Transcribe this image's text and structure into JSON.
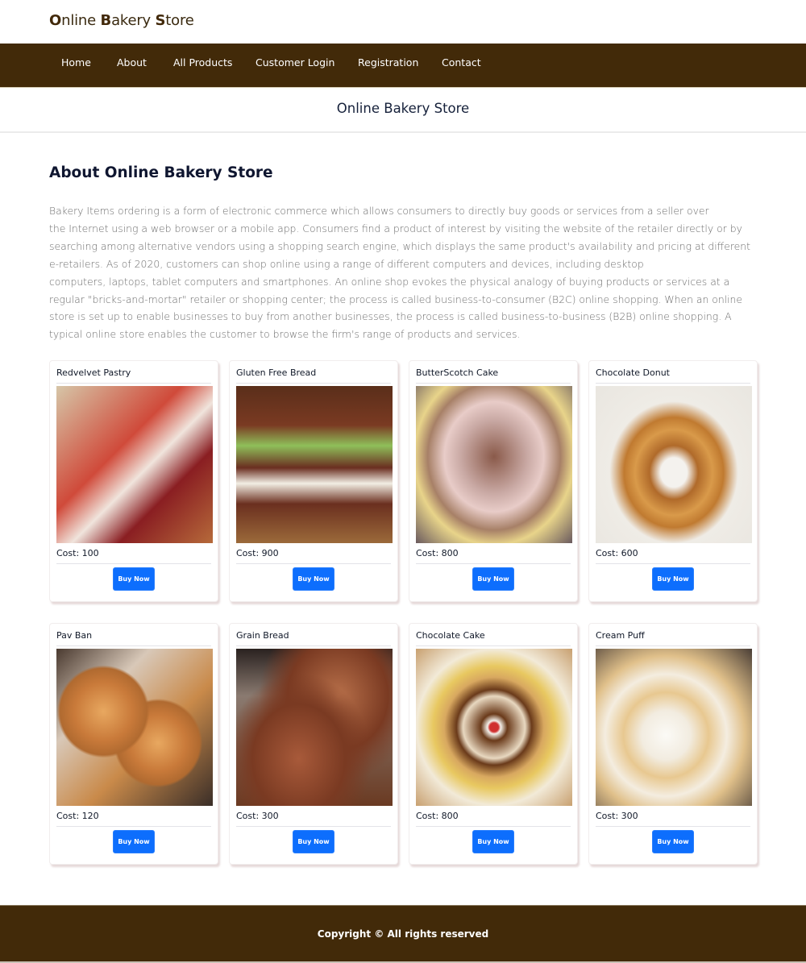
{
  "brand": {
    "first": "O",
    "rest1": "nline ",
    "second": "B",
    "rest2": "akery ",
    "third": "S",
    "rest3": "tore"
  },
  "nav": {
    "items": [
      {
        "label": "Home"
      },
      {
        "label": "About"
      },
      {
        "label": "All Products"
      },
      {
        "label": "Customer Login"
      },
      {
        "label": "Registration"
      },
      {
        "label": "Contact"
      }
    ]
  },
  "subheader": {
    "title": "Online Bakery Store"
  },
  "about": {
    "title": "About Online Bakery Store",
    "lines": [
      "Bakery Items ordering is a form of electronic commerce which allows consumers to directly buy goods or services from a seller over",
      "the Internet using a web browser or a mobile app. Consumers find a product of interest by visiting the website of the retailer directly or by",
      "searching among alternative vendors using a shopping search engine, which displays the same product's availability and pricing at different",
      "e-retailers. As of 2020, customers can shop online using a range of different computers and devices, including desktop",
      "computers, laptops, tablet computers and smartphones. An online shop evokes the physical analogy of buying products or services at a",
      "regular \"bricks-and-mortar\" retailer or shopping center; the process is called business-to-consumer (B2C) online shopping. When an online",
      "store is set up to enable businesses to buy from another businesses, the process is called business-to-business (B2B) online shopping. A",
      "typical online store enables the customer to browse the firm's range of products and services."
    ]
  },
  "products": [
    {
      "name": "Redvelvet Pastry",
      "cost": "Cost: 100",
      "button": "Buy Now"
    },
    {
      "name": "Gluten Free Bread",
      "cost": "Cost: 900",
      "button": "Buy Now"
    },
    {
      "name": "ButterScotch Cake",
      "cost": "Cost: 800",
      "button": "Buy Now"
    },
    {
      "name": "Chocolate Donut",
      "cost": "Cost: 600",
      "button": "Buy Now"
    },
    {
      "name": "Pav Ban",
      "cost": "Cost: 120",
      "button": "Buy Now"
    },
    {
      "name": "Grain Bread",
      "cost": "Cost: 300",
      "button": "Buy Now"
    },
    {
      "name": "Chocolate Cake",
      "cost": "Cost: 800",
      "button": "Buy Now"
    },
    {
      "name": "Cream Puff",
      "cost": "Cost: 300",
      "button": "Buy Now"
    }
  ],
  "footer": {
    "text": "Copyright © All rights reserved"
  },
  "colors": {
    "brand_brown": "#422a09",
    "button_blue": "#0d6efd"
  }
}
